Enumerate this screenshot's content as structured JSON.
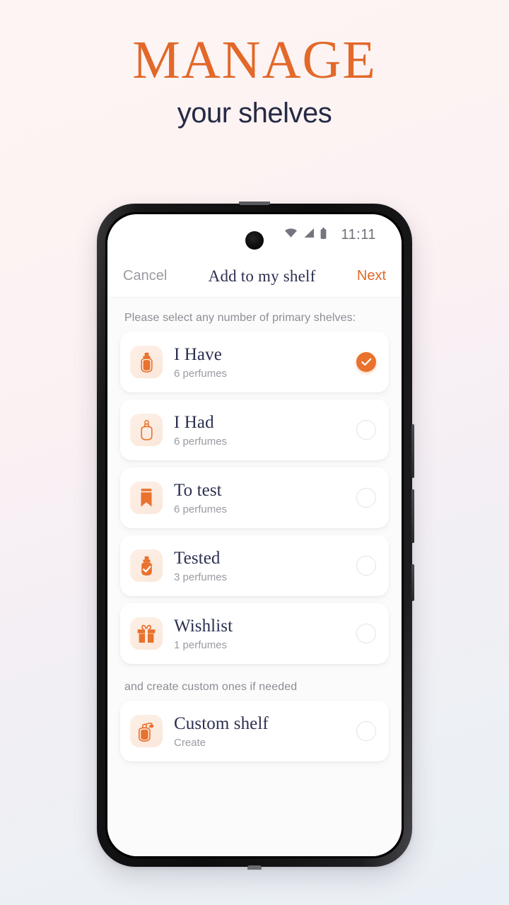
{
  "promo": {
    "headline": "MANAGE",
    "subheadline": "your shelves",
    "accent_color": "#e2692a",
    "dark_color": "#252a45"
  },
  "phone": {
    "statusbar": {
      "time": "11:11",
      "icons": [
        "wifi-icon",
        "cellular-signal-icon",
        "battery-icon"
      ]
    },
    "navbar": {
      "cancel_label": "Cancel",
      "title": "Add to my shelf",
      "next_label": "Next"
    },
    "content": {
      "primary_label": "Please select any number of primary shelves:",
      "custom_label": "and create custom ones if needed",
      "primary_shelves": [
        {
          "title": "I Have",
          "subtitle": "6 perfumes",
          "icon": "perfume-bottle-filled-icon",
          "selected": true
        },
        {
          "title": "I Had",
          "subtitle": "6 perfumes",
          "icon": "perfume-bottle-outline-icon",
          "selected": false
        },
        {
          "title": "To test",
          "subtitle": "6 perfumes",
          "icon": "bookmark-icon",
          "selected": false
        },
        {
          "title": "Tested",
          "subtitle": "3 perfumes",
          "icon": "perfume-bottle-check-icon",
          "selected": false
        },
        {
          "title": "Wishlist",
          "subtitle": "1 perfumes",
          "icon": "gift-icon",
          "selected": false
        }
      ],
      "custom_shelves": [
        {
          "title": "Custom shelf",
          "subtitle": "Create",
          "icon": "perfume-atomizer-icon",
          "selected": false
        }
      ]
    }
  }
}
